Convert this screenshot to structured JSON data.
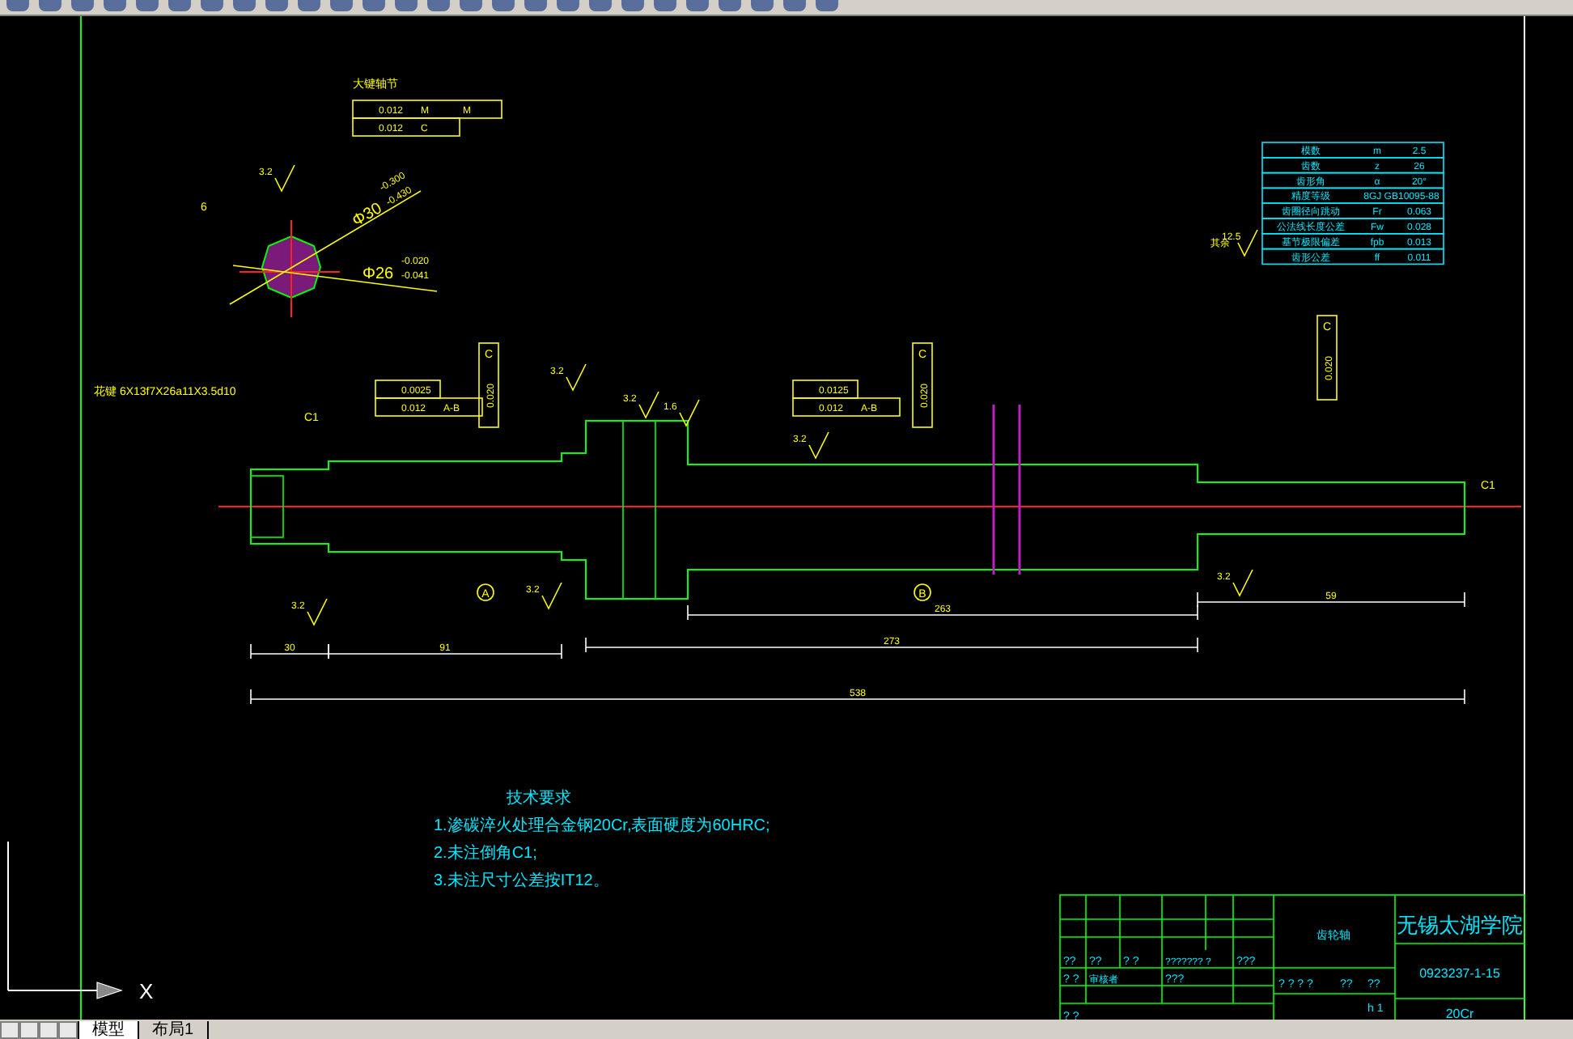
{
  "section_view": {
    "title": "大键轴节",
    "frames": [
      [
        "0.012",
        "M",
        "M"
      ],
      [
        "0.012",
        "C"
      ]
    ],
    "width_dim": "6",
    "roughness": "3.2",
    "outer_dim": {
      "base": "Φ30",
      "upper": "-0.300",
      "lower": "-0.430"
    },
    "inner_dim": {
      "base": "Φ26",
      "upper": "-0.020",
      "lower": "-0.041"
    }
  },
  "spline_label": "花键 6X13f7X26a11X3.5d10",
  "gear_table": [
    {
      "name": "模数",
      "symbol": "m",
      "value": "2.5"
    },
    {
      "name": "齿数",
      "symbol": "z",
      "value": "26"
    },
    {
      "name": "齿形角",
      "symbol": "α",
      "value": "20°"
    },
    {
      "name": "精度等级",
      "value": "8GJ GB10095-88"
    },
    {
      "name": "齿圈径向跳动",
      "symbol": "Fr",
      "value": "0.063"
    },
    {
      "name": "公法线长度公差",
      "symbol": "Fw",
      "value": "0.028"
    },
    {
      "name": "基节极限偏差",
      "symbol": "fpb",
      "value": "0.013"
    },
    {
      "name": "齿形公差",
      "symbol": "ff",
      "value": "0.011"
    }
  ],
  "other_roughness": {
    "label": "其余",
    "value": "12.5"
  },
  "shaft": {
    "chamfers": [
      "C1",
      "C1"
    ],
    "left_frames": [
      [
        "0.0025"
      ],
      [
        "0.012",
        "A-B"
      ]
    ],
    "mid_frames": [
      [
        "0.0125"
      ],
      [
        "0.012",
        "A-B"
      ]
    ],
    "datums": [
      "C",
      "C",
      "C"
    ],
    "runouts": [
      "0.020",
      "0.020",
      "0.020"
    ],
    "datum_marks": [
      "A",
      "B"
    ],
    "roughness": [
      "3.2",
      "3.2",
      "1.6",
      "3.2",
      "3.2",
      "3.2",
      "3.2"
    ],
    "dims": [
      {
        "kind": "horizontal",
        "text": "30"
      },
      {
        "kind": "horizontal",
        "text": "91"
      },
      {
        "kind": "horizontal",
        "text": "273"
      },
      {
        "kind": "horizontal",
        "text": "538"
      },
      {
        "kind": "horizontal",
        "text": "263"
      },
      {
        "kind": "horizontal",
        "text": "59"
      }
    ]
  },
  "requirements": {
    "title": "技术要求",
    "lines": [
      "1.渗碳淬火处理合金钢20Cr,表面硬度为60HRC;",
      "2.未注倒角C1;",
      "3.未注尺寸公差按IT12。"
    ]
  },
  "title_block": {
    "school": "无锡太湖学院",
    "part_name": "齿轮轴",
    "drawing_no": "0923237-1-15",
    "material": "20Cr",
    "cells": [
      "??",
      "??",
      "? ?",
      "??????? ?",
      "???",
      "? ?",
      "审核者",
      "???",
      "? ? ? ?",
      "??",
      "??",
      "? ?",
      "h 1"
    ]
  },
  "tabs": [
    {
      "label": "模型",
      "selected": true
    },
    {
      "label": "布局1",
      "selected": false
    }
  ],
  "axis_label": "X"
}
